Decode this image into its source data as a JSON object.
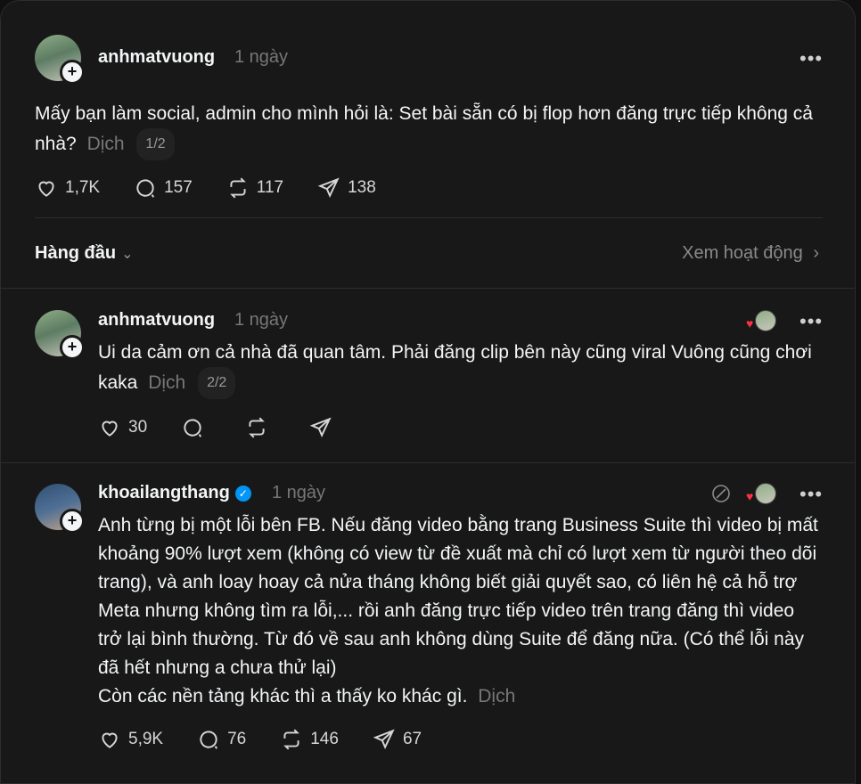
{
  "post": {
    "username": "anhmatvuong",
    "time": "1 ngày",
    "text": "Mấy bạn làm social, admin cho mình hỏi là: Set bài sẵn có bị flop hơn đăng trực tiếp không cả nhà?",
    "translate": "Dịch",
    "pager": "1/2",
    "likes": "1,7K",
    "comments": "157",
    "reposts": "117",
    "shares": "138"
  },
  "filter": {
    "label": "Hàng đầu",
    "activity_label": "Xem hoạt động"
  },
  "replies": [
    {
      "username": "anhmatvuong",
      "time": "1 ngày",
      "text": "Ui da cảm ơn cả nhà đã quan tâm. Phải đăng clip bên này cũng viral Vuông cũng chơi kaka",
      "translate": "Dịch",
      "pager": "2/2",
      "likes": "30"
    },
    {
      "username": "khoailangthang",
      "time": "1 ngày",
      "text": "Anh từng bị một lỗi bên FB. Nếu đăng video bằng trang Business Suite thì video bị mất khoảng 90% lượt xem (không có view từ đề xuất mà chỉ có lượt xem từ người theo dõi trang), và anh loay hoay cả nửa tháng không biết giải quyết sao, có liên hệ cả hỗ trợ Meta nhưng không tìm ra lỗi,... rồi anh đăng trực tiếp video trên trang đăng thì video trở lại bình thường. Từ đó về sau anh không dùng Suite để đăng nữa. (Có thể lỗi này đã hết nhưng a chưa thử lại)",
      "text2": "Còn các nền tảng khác thì a thấy ko khác gì.",
      "translate": "Dịch",
      "likes": "5,9K",
      "comments": "76",
      "reposts": "146",
      "shares": "67"
    }
  ],
  "icons": {
    "like": "heart-icon",
    "comment": "comment-icon",
    "repost": "repost-icon",
    "share": "send-icon",
    "more": "more-icon",
    "verified": "verified-badge-icon"
  },
  "colors": {
    "background": "#181818",
    "text": "#f3f5f7",
    "muted": "#777777",
    "verified": "#0095f6",
    "heart": "#ff3040"
  }
}
